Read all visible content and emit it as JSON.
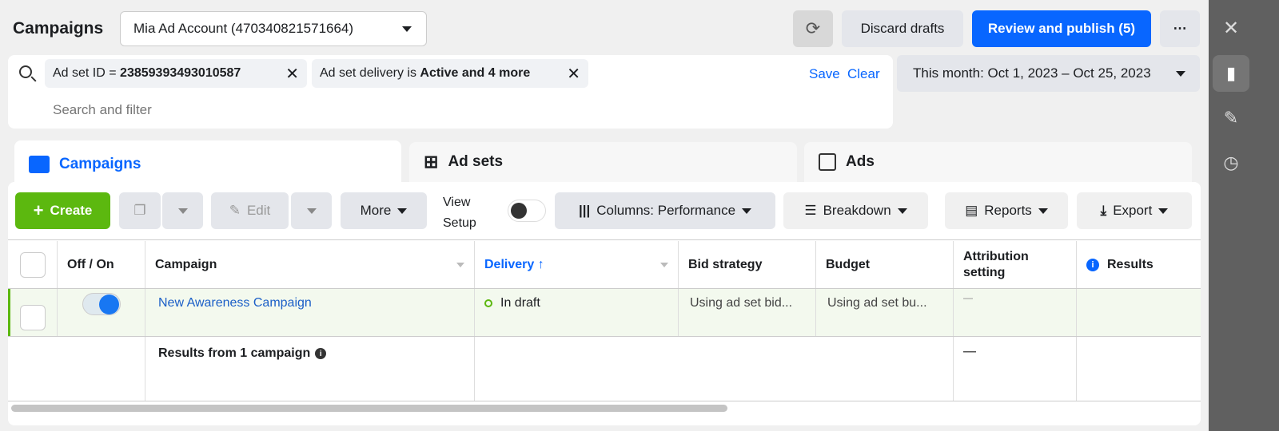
{
  "header": {
    "title": "Campaigns",
    "account": "Mia Ad Account (470340821571664)",
    "discard": "Discard drafts",
    "publish": "Review and publish (5)",
    "more": "⋯"
  },
  "filters": {
    "chip1_label": "Ad set ID = ",
    "chip1_value": "23859393493010587",
    "chip2_label": "Ad set delivery is ",
    "chip2_value": "Active and 4 more",
    "save": "Save",
    "clear": "Clear",
    "placeholder": "Search and filter",
    "date": "This month: Oct 1, 2023 – Oct 25, 2023"
  },
  "tabs": [
    {
      "label": "Campaigns",
      "active": true
    },
    {
      "label": "Ad sets"
    },
    {
      "label": "Ads"
    }
  ],
  "toolbar": {
    "create": "Create",
    "edit": "Edit",
    "more": "More",
    "view_setup": "View Setup",
    "columns": "Columns: Performance",
    "breakdown": "Breakdown",
    "reports": "Reports",
    "export": "Export"
  },
  "table": {
    "columns": [
      "Off / On",
      "Campaign",
      "Delivery",
      "Bid strategy",
      "Budget",
      "Attribution setting",
      "Results"
    ],
    "rows": [
      {
        "on": true,
        "campaign": "New Awareness Campaign",
        "delivery": "In draft",
        "bid": "Using ad set bid...",
        "budget": "Using ad set bu...",
        "attribution": "—",
        "results": ""
      }
    ],
    "summary": {
      "label": "Results from 1 campaign",
      "attribution": "—"
    }
  },
  "colors": {
    "accent": "#0866ff",
    "create": "#5cb80f",
    "sidebar": "#606060",
    "row_highlight": "#f3f9ee"
  }
}
